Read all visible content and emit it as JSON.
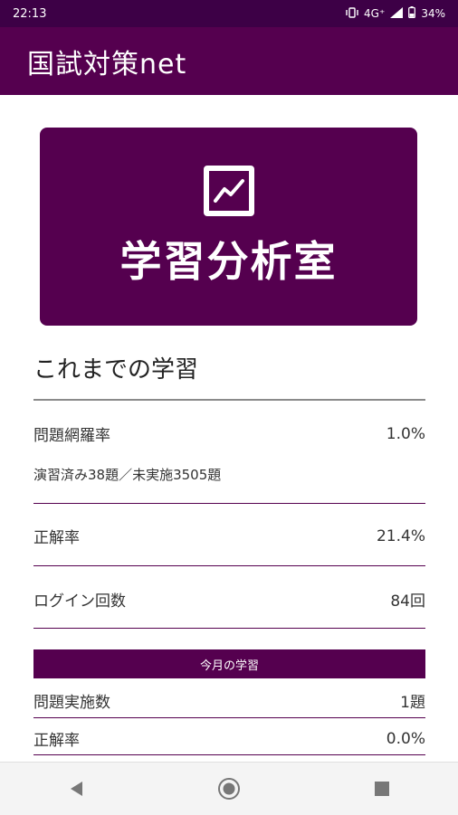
{
  "status_bar": {
    "time": "22:13",
    "network": "4G⁺",
    "battery": "34%"
  },
  "app_bar": {
    "title": "国試対策net"
  },
  "hero": {
    "title": "学習分析室",
    "icon": "trending-up-chart-icon"
  },
  "section": {
    "title": "これまでの学習"
  },
  "stats": {
    "coverage_label": "問題網羅率",
    "coverage_value": "1.0%",
    "coverage_detail": "演習済み38題／未実施3505題",
    "accuracy_label": "正解率",
    "accuracy_value": "21.4%",
    "logins_label": "ログイン回数",
    "logins_value": "84回"
  },
  "month": {
    "header": "今月の学習",
    "solved_label": "問題実施数",
    "solved_value": "1題",
    "accuracy_label": "正解率",
    "accuracy_value": "0.0%"
  },
  "colors": {
    "brand": "#55004f",
    "status_bar": "#3d0046"
  }
}
